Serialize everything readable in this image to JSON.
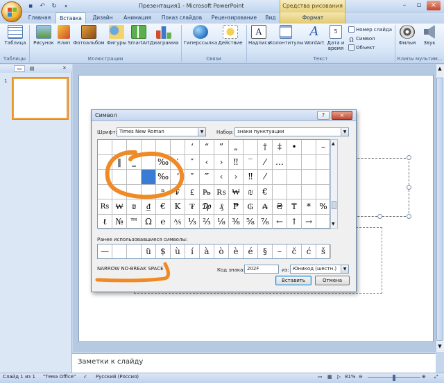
{
  "window": {
    "title": "Презентация1 - Microsoft PowerPoint",
    "contextual_tab_group": "Средства рисования"
  },
  "quick_access": [
    "save",
    "undo",
    "redo",
    "customize"
  ],
  "tabs": [
    "Главная",
    "Вставка",
    "Дизайн",
    "Анимация",
    "Показ слайдов",
    "Рецензирование",
    "Вид",
    "Формат"
  ],
  "active_tab": "Вставка",
  "ribbon": {
    "groups": [
      {
        "label": "Таблицы",
        "buttons": [
          "Таблица"
        ]
      },
      {
        "label": "Иллюстрации",
        "buttons": [
          "Рисунок",
          "Клип",
          "Фотоальбом",
          "Фигуры",
          "SmartArt",
          "Диаграмма"
        ]
      },
      {
        "label": "Связи",
        "buttons": [
          "Гиперссылка",
          "Действие"
        ]
      },
      {
        "label": "Текст",
        "buttons": [
          "Надпись",
          "Колонтитулы",
          "WordArt",
          "Дата и время"
        ],
        "small_buttons": [
          "Номер слайда",
          "Символ",
          "Объект"
        ]
      },
      {
        "label": "Клипы мультим...",
        "buttons": [
          "Фильм",
          "Звук"
        ]
      }
    ]
  },
  "slides_pane": {
    "slide_number": "1"
  },
  "notes": {
    "placeholder": "Заметки к слайду"
  },
  "status": {
    "slide": "Слайд 1 из 1",
    "theme": "\"Тема Office\"",
    "language": "Русский (Россия)",
    "zoom": "81%"
  },
  "dialog": {
    "title": "Символ",
    "help": "?",
    "close": "×",
    "font_label": "Шрифт:",
    "font_value": "Times New Roman",
    "subset_label": "Набор:",
    "subset_value": "знаки пунктуации",
    "grid": [
      [
        "",
        "",
        "",
        "",
        "",
        "",
        "‘",
        "’",
        "‚",
        "‛",
        "“",
        "”",
        "„",
        "",
        "†",
        "‡",
        "•",
        "",
        "",
        "",
        "–",
        "—",
        "",
        ""
      ],
      [
        "",
        "",
        "",
        "",
        "",
        "",
        "",
        "‖",
        "‗",
        "",
        "",
        "",
        "",
        "",
        "",
        "",
        "",
        "",
        "",
        "",
        "",
        "",
        "",
        ""
      ],
      [
        "",
        "",
        "",
        "",
        "",
        "",
        "",
        "",
        "",
        "",
        "",
        "",
        "",
        "",
        "",
        "",
        "",
        "",
        "",
        "",
        "",
        "",
        "",
        ""
      ],
      [
        "",
        "",
        "",
        "",
        "",
        "",
        "",
        "",
        "",
        "",
        "",
        "",
        "",
        "",
        "",
        "",
        "",
        "",
        "",
        "",
        "",
        "",
        "",
        ""
      ],
      [
        "",
        "",
        "",
        "",
        "",
        "",
        "",
        "",
        "",
        "",
        "",
        "",
        "",
        "",
        "",
        "",
        "",
        "",
        "",
        "",
        "",
        "",
        "",
        ""
      ],
      [
        "",
        "",
        "",
        "",
        "",
        "",
        "",
        "",
        "",
        "",
        "",
        "",
        "",
        "",
        "",
        "",
        "",
        "",
        "",
        "",
        "",
        "",
        "",
        ""
      ]
    ],
    "rows": [
      [
        "",
        "",
        "",
        "",
        "",
        "‘",
        "’",
        "‚",
        "‛",
        "“",
        "”",
        "„",
        "",
        "†",
        "‡",
        "•",
        "",
        "",
        "–",
        "—"
      ],
      [
        "",
        "",
        "",
        "",
        "",
        "",
        "",
        "",
        "",
        "",
        "",
        "",
        "",
        "",
        "",
        "",
        "",
        "",
        "",
        ""
      ]
    ],
    "char_rows": [
      [
        "",
        "",
        "",
        "",
        "",
        "‘",
        "’",
        "‚",
        "‛",
        "“",
        "”",
        "„",
        "",
        "†",
        "‡",
        "•",
        "",
        "",
        "",
        "",
        "–",
        "—"
      ]
    ],
    "symbol_rows": [
      [
        "",
        "",
        "",
        "",
        "",
        "‘",
        "’",
        "",
        "“",
        "”",
        "„",
        "‟",
        "†",
        "‡",
        "•",
        "",
        "",
        "–",
        "—",
        ""
      ],
      [
        "",
        "′",
        "‖",
        "",
        "",
        "‰",
        "′",
        "″",
        "‴",
        "‹",
        "›",
        "‼",
        "‾",
        "⁄",
        "",
        "…",
        "",
        "",
        "",
        ""
      ],
      [
        "",
        "",
        "",
        "",
        "",
        "",
        "ⁿ",
        "₣",
        "₤",
        "₧",
        "₨",
        "₩",
        "₪",
        "€",
        "",
        "",
        "",
        "",
        "",
        ""
      ],
      [
        "Rs",
        "₩",
        "₪",
        "₫",
        "€",
        "K",
        "₮",
        "₯",
        "₰",
        "₱",
        "₲",
        "₳",
        "₴",
        "₸",
        "*",
        "%",
        "",
        "",
        "",
        ""
      ],
      [
        "ℓ",
        "№",
        "™",
        "Ω",
        "℮",
        "⅍",
        "⅓",
        "⅔",
        "⅛",
        "⅜",
        "⅝",
        "⅞",
        "←",
        "↑",
        "→",
        "",
        "",
        "",
        "",
        ""
      ]
    ],
    "visible_grid": [
      [
        "",
        "",
        "",
        "",
        "",
        "",
        "ʻ",
        "“",
        "”",
        "„",
        "",
        "†",
        "‡",
        "•",
        "",
        "–",
        "—"
      ],
      [
        "",
        "‖",
        "‗",
        "",
        "‰",
        "′",
        "″",
        "‹",
        "›",
        "‼",
        "‾",
        "⁄",
        "…",
        "",
        "",
        "",
        ""
      ],
      [
        "",
        "",
        "",
        "",
        "‰",
        "ʼ",
        "″",
        "‴",
        "‹",
        "›",
        "‼",
        "⁄",
        "",
        "",
        "",
        "",
        ""
      ],
      [
        "",
        "",
        "",
        "",
        "ⁿ",
        "₣",
        "₤",
        "₧",
        "₨",
        "₩",
        "₪",
        "€",
        "",
        "",
        "",
        "",
        ""
      ],
      [
        "Rs",
        "₩",
        "₪",
        "₫",
        "€",
        "K",
        "₮",
        "₯",
        "₰",
        "₱",
        "₲",
        "₳",
        "₴",
        "₸",
        "*",
        "%",
        ""
      ],
      [
        "ℓ",
        "№",
        "™",
        "Ω",
        "℮",
        "⅍",
        "⅓",
        "⅔",
        "⅛",
        "⅜",
        "⅝",
        "⅞",
        "←",
        "↑",
        "→",
        "",
        ""
      ]
    ],
    "selected": {
      "row": 2,
      "col": 3
    },
    "recent_label": "Ранее использовавшиеся символы:",
    "recent": [
      "—",
      "",
      "",
      "ü",
      "$",
      "ù",
      "í",
      "à",
      "ò",
      "è",
      "é",
      "§",
      "–",
      "č",
      "ć",
      "š",
      "€"
    ],
    "char_name": "NARROW NO-BREAK SPACE",
    "code_label": "Код знака:",
    "code_value": "202F",
    "from_label": "из:",
    "from_value": "Юникод (шестн.)",
    "insert": "Вставить",
    "cancel": "Отмена"
  },
  "colors": {
    "ribbon_blue": "#d6e5f7",
    "annotation_orange": "#f08a24",
    "selection_blue": "#3a7bd5"
  }
}
